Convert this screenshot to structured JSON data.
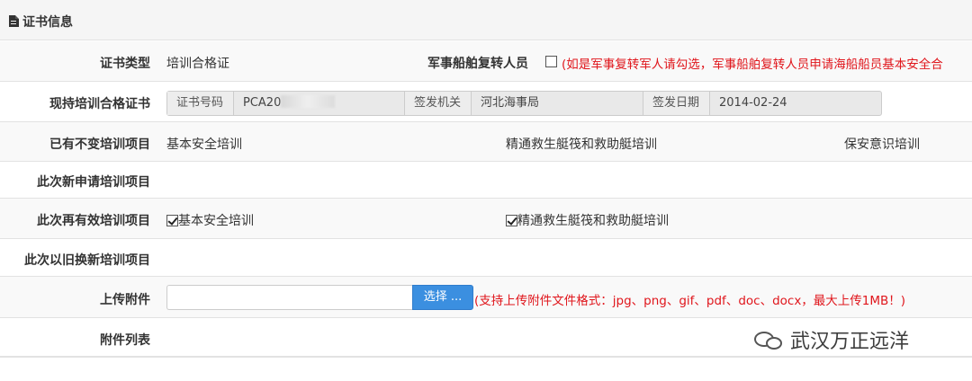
{
  "panel": {
    "title": "证书信息",
    "icon": "document-icon"
  },
  "rows": {
    "cert_type": {
      "label": "证书类型",
      "value": "培训合格证"
    },
    "military": {
      "label": "军事船舶复转人员",
      "hint": "(如是军事复转军人请勾选，军事船舶复转人员申请海船船员基本安全合",
      "checked": false
    },
    "current_cert": {
      "label": "现持培训合格证书",
      "number_label": "证书号码",
      "number_value": "PCA20",
      "authority_label": "签发机关",
      "authority_value": "河北海事局",
      "date_label": "签发日期",
      "date_value": "2014-02-24"
    },
    "existing": {
      "label": "已有不变培训项目",
      "items": [
        "基本安全培训",
        "精通救生艇筏和救助艇培训",
        "保安意识培训"
      ]
    },
    "new_apply": {
      "label": "此次新申请培训项目"
    },
    "revalidate": {
      "label": "此次再有效培训项目",
      "items": [
        {
          "label": "基本安全培训",
          "checked": true
        },
        {
          "label": "精通救生艇筏和救助艇培训",
          "checked": true
        }
      ]
    },
    "replace": {
      "label": "此次以旧换新培训项目"
    },
    "upload": {
      "label": "上传附件",
      "button": "选择 ...",
      "hint": "(支持上传附件文件格式：jpg、png、gif、pdf、doc、docx，最大上传1MB！)"
    },
    "attachments": {
      "label": "附件列表"
    }
  },
  "watermark": {
    "text": "武汉万正远洋"
  },
  "colors": {
    "accent": "#3b8fe0",
    "warning": "#e0161c",
    "row_shade": "#f9f9f9"
  }
}
